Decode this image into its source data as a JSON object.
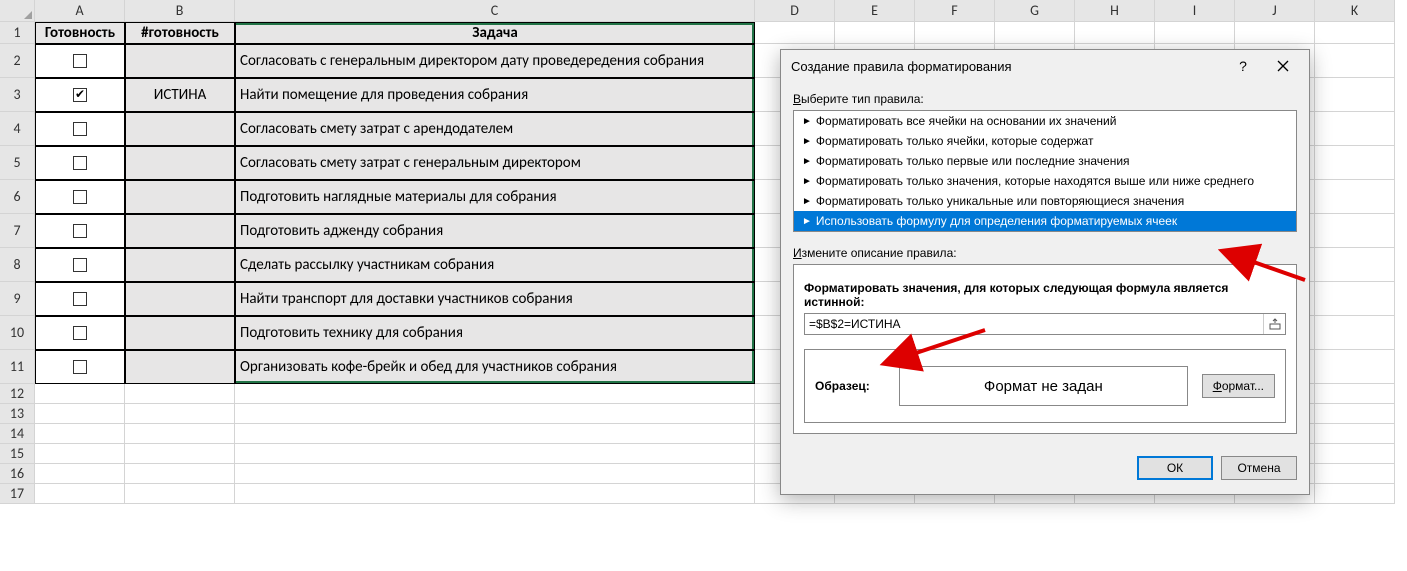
{
  "columns": [
    "A",
    "B",
    "C",
    "D",
    "E",
    "F",
    "G",
    "H",
    "I",
    "J",
    "K"
  ],
  "headers": {
    "a": "Готовность",
    "b": "#готовность",
    "c": "Задача"
  },
  "rows": [
    {
      "n": 2,
      "checked": false,
      "bval": "",
      "task": "Согласовать с генеральным директором дату проведередения собрания"
    },
    {
      "n": 3,
      "checked": true,
      "bval": "ИСТИНА",
      "task": "Найти помещение для проведения собрания"
    },
    {
      "n": 4,
      "checked": false,
      "bval": "",
      "task": "Согласовать смету затрат с арендодателем"
    },
    {
      "n": 5,
      "checked": false,
      "bval": "",
      "task": "Согласовать смету затрат с генеральным директором"
    },
    {
      "n": 6,
      "checked": false,
      "bval": "",
      "task": "Подготовить наглядные материалы для собрания"
    },
    {
      "n": 7,
      "checked": false,
      "bval": "",
      "task": "Подготовить адженду собрания"
    },
    {
      "n": 8,
      "checked": false,
      "bval": "",
      "task": "Сделать рассылку участникам собрания"
    },
    {
      "n": 9,
      "checked": false,
      "bval": "",
      "task": "Найти транспорт для доставки участников собрания"
    },
    {
      "n": 10,
      "checked": false,
      "bval": "",
      "task": "Подготовить технику для собрания"
    },
    {
      "n": 11,
      "checked": false,
      "bval": "",
      "task": "Организовать кофе-брейк и обед для участников собрания"
    }
  ],
  "empty_rows": [
    12,
    13,
    14,
    15,
    16,
    17
  ],
  "dialog": {
    "title": "Создание правила форматирования",
    "help": "?",
    "select_rule_label_pre": "В",
    "select_rule_label": "ыберите тип правила:",
    "rules": [
      "Форматировать все ячейки на основании их значений",
      "Форматировать только ячейки, которые содержат",
      "Форматировать только первые или последние значения",
      "Форматировать только значения, которые находятся выше или ниже среднего",
      "Форматировать только уникальные или повторяющиеся значения",
      "Использовать формулу для определения форматируемых ячеек"
    ],
    "selected_rule": 5,
    "edit_label_pre": "И",
    "edit_label": "змените описание правила:",
    "formula_label": "Форматировать значения, для которых следующая формула является истинной:",
    "formula_value": "=$B$2=ИСТИНА",
    "preview_label": "Образец:",
    "preview_text": "Формат не задан",
    "format_btn_pre": "Ф",
    "format_btn": "ормат...",
    "ok": "ОК",
    "cancel": "Отмена"
  }
}
